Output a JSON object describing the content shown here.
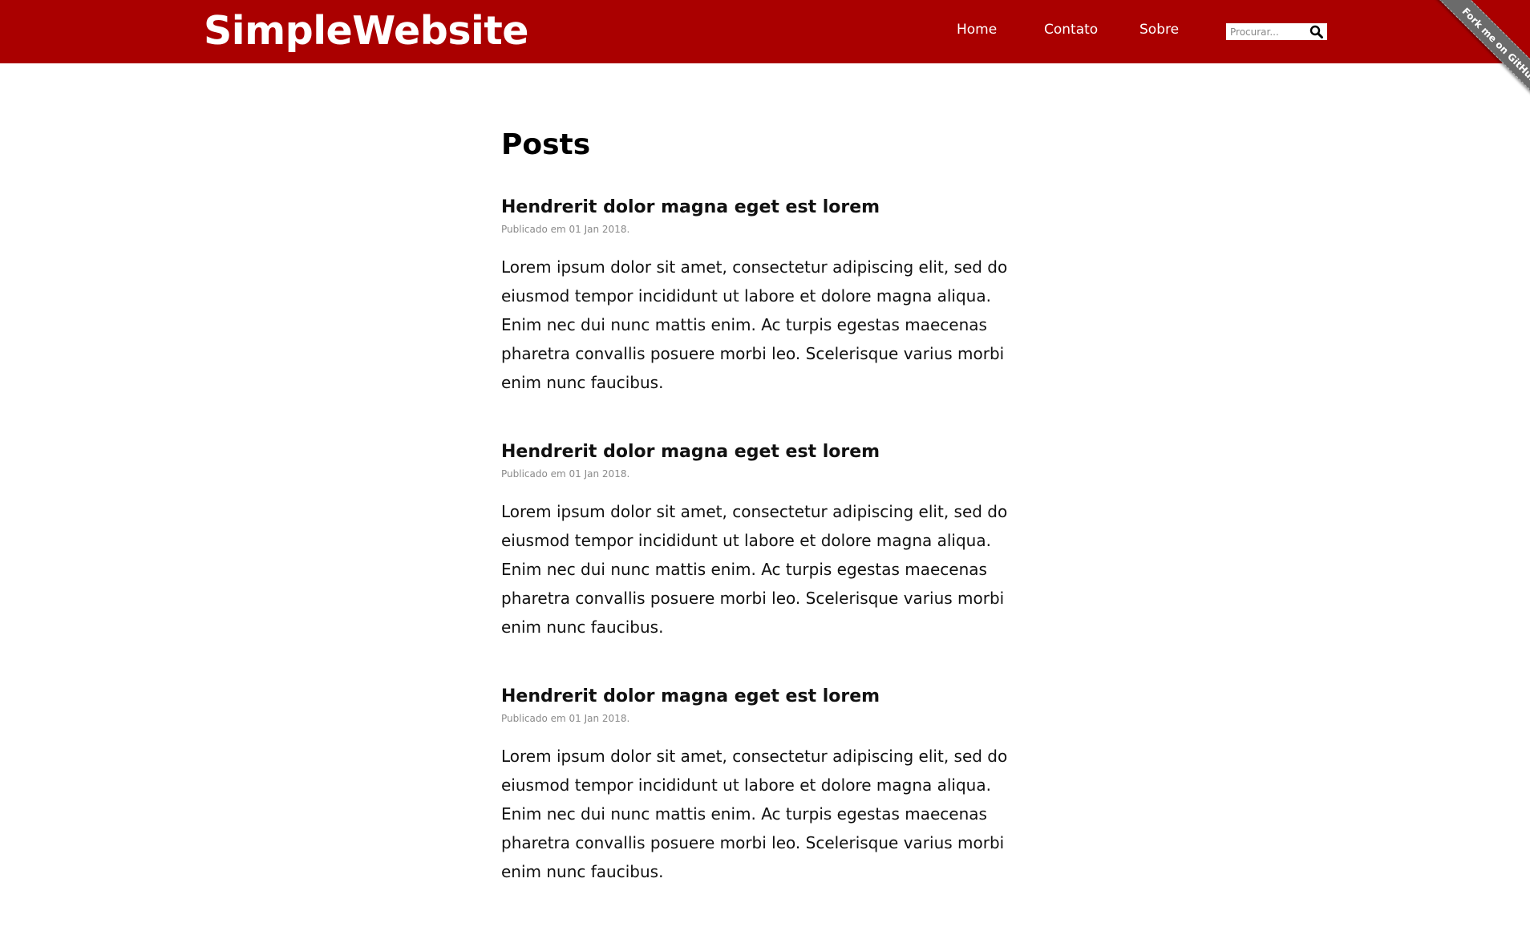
{
  "header": {
    "brand": "SimpleWebsite",
    "nav": [
      {
        "label": "Home"
      },
      {
        "label": "Contato"
      },
      {
        "label": "Sobre"
      }
    ],
    "search": {
      "placeholder": "Procurar...",
      "icon": "search-icon"
    }
  },
  "ribbon": {
    "label": "Fork me on GitHub"
  },
  "colors": {
    "header_bg": "#aa0000",
    "ribbon_bg": "#6b6b6b"
  },
  "main": {
    "title": "Posts",
    "posts": [
      {
        "title": "Hendrerit dolor magna eget est lorem",
        "date": "Publicado em 01 Jan 2018.",
        "body": "Lorem ipsum dolor sit amet, consectetur adipiscing elit, sed do eiusmod tempor incididunt ut labore et dolore magna aliqua. Enim nec dui nunc mattis enim. Ac turpis egestas maecenas pharetra convallis posuere morbi leo. Scelerisque varius morbi enim nunc faucibus."
      },
      {
        "title": "Hendrerit dolor magna eget est lorem",
        "date": "Publicado em 01 Jan 2018.",
        "body": "Lorem ipsum dolor sit amet, consectetur adipiscing elit, sed do eiusmod tempor incididunt ut labore et dolore magna aliqua. Enim nec dui nunc mattis enim. Ac turpis egestas maecenas pharetra convallis posuere morbi leo. Scelerisque varius morbi enim nunc faucibus."
      },
      {
        "title": "Hendrerit dolor magna eget est lorem",
        "date": "Publicado em 01 Jan 2018.",
        "body": "Lorem ipsum dolor sit amet, consectetur adipiscing elit, sed do eiusmod tempor incididunt ut labore et dolore magna aliqua. Enim nec dui nunc mattis enim. Ac turpis egestas maecenas pharetra convallis posuere morbi leo. Scelerisque varius morbi enim nunc faucibus."
      }
    ]
  }
}
